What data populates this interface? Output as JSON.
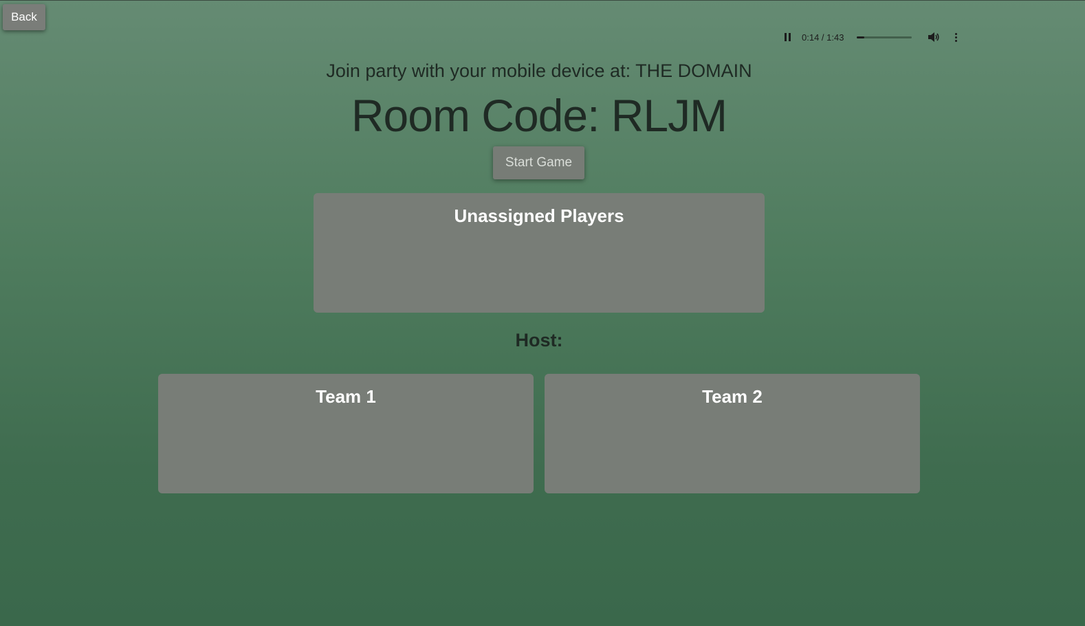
{
  "nav": {
    "back_label": "Back"
  },
  "audio": {
    "time": "0:14 / 1:43",
    "progress_fraction": 0.14,
    "icons": [
      "pause-icon",
      "volume-icon",
      "more-options-icon"
    ]
  },
  "header": {
    "join_text": "Join party with your mobile device at: THE DOMAIN",
    "room_code": "Room Code: RLJM"
  },
  "actions": {
    "start_label": "Start Game"
  },
  "panels": {
    "unassigned_title": "Unassigned Players",
    "host_label": "Host:",
    "team1_title": "Team 1",
    "team2_title": "Team 2"
  },
  "colors": {
    "background_top": "#658b73",
    "background_bottom": "#3a684b",
    "panel": "#787d77",
    "button": "#777c76"
  }
}
